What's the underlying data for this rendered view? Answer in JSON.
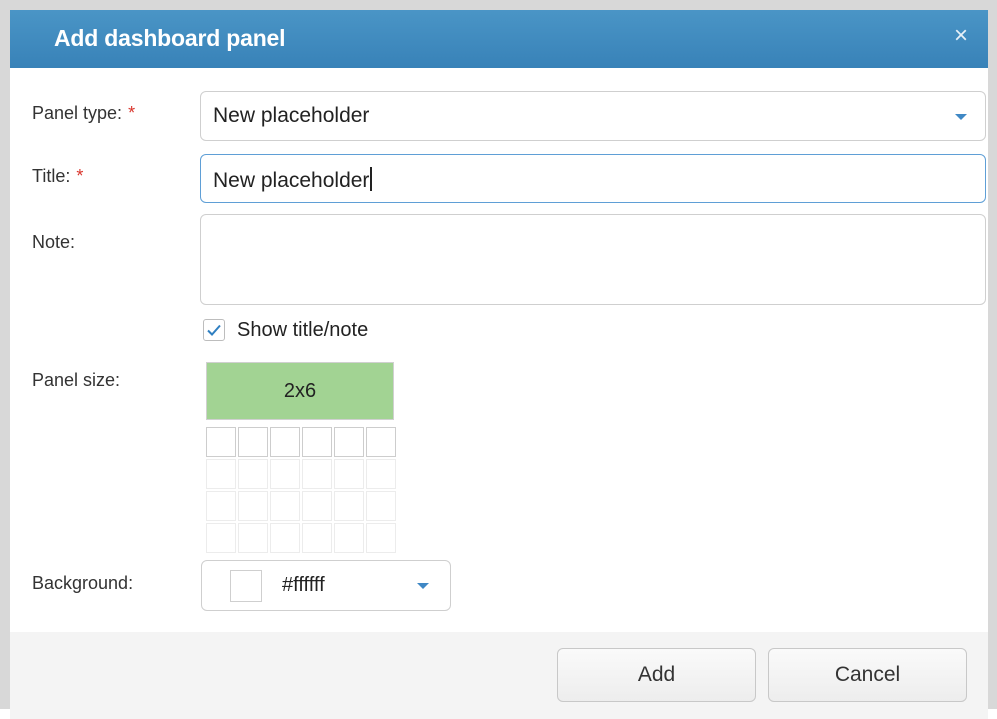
{
  "dialog": {
    "title": "Add dashboard panel",
    "close_glyph": "×",
    "close_icon": "close-icon"
  },
  "form": {
    "panel_type": {
      "label": "Panel type:",
      "required_mark": "*",
      "value": "New placeholder",
      "caret_icon": "chevron-down-icon"
    },
    "title": {
      "label": "Title:",
      "required_mark": "*",
      "value": "New placeholder"
    },
    "note": {
      "label": "Note:",
      "value": ""
    },
    "show_title_note": {
      "label": "Show title/note",
      "checked": true,
      "check_icon": "check-icon"
    },
    "panel_size": {
      "label": "Panel size:",
      "value": "2x6",
      "grid_columns": 6,
      "grid_rows": 4
    },
    "background": {
      "label": "Background:",
      "value": "#ffffff",
      "caret_icon": "chevron-down-icon"
    }
  },
  "footer": {
    "add_label": "Add",
    "cancel_label": "Cancel"
  },
  "colors": {
    "header": "#3c87bd",
    "accent": "#3f88c5",
    "required": "#d9342b",
    "size_selected": "#a2d393",
    "footer_bg": "#f4f4f4"
  }
}
